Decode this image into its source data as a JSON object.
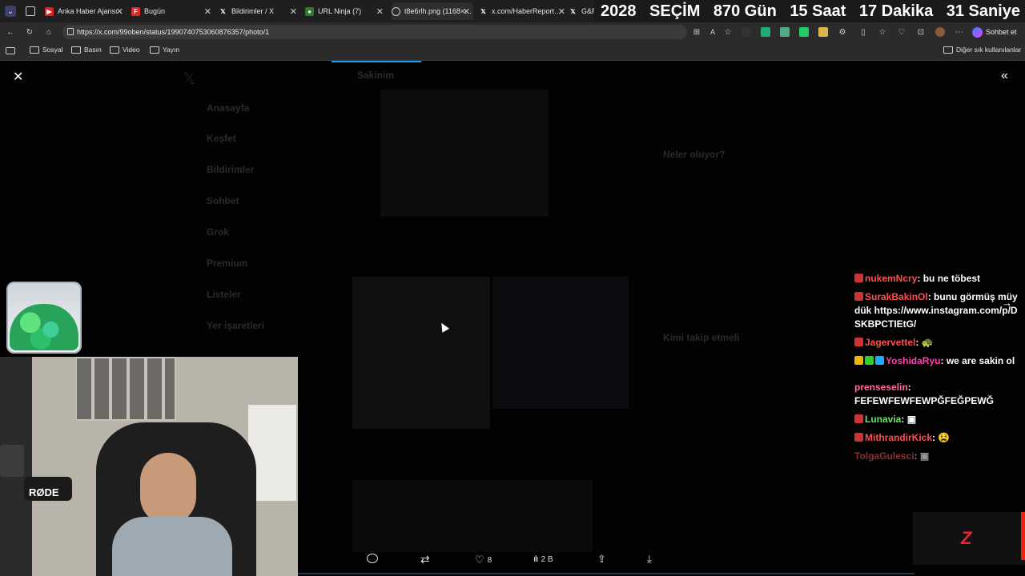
{
  "tabs": [
    {
      "label": "Anka Haber Ajansı",
      "icon": "youtube-icon",
      "color": "#e02020"
    },
    {
      "label": "Bugün",
      "icon": "flipboard-icon",
      "color": "#e12828"
    },
    {
      "label": "Bildirimler / X",
      "icon": "x-icon",
      "color": "#000000"
    },
    {
      "label": "URL Ninja (7)",
      "icon": "ninja-icon",
      "color": "#2d7a2d"
    },
    {
      "label": "t8e6rlh.png (1168×…",
      "icon": "globe-icon",
      "color": "#555555"
    },
    {
      "label": "x.com/HaberReport…",
      "icon": "x-icon",
      "color": "#000000"
    },
    {
      "label": "G&R",
      "icon": "x-icon",
      "color": "#000000"
    }
  ],
  "countdown": {
    "year": "2028",
    "title": "SEÇİM",
    "days": "870 Gün",
    "hours": "15 Saat",
    "minutes": "17 Dakika",
    "seconds": "31 Saniye"
  },
  "address": {
    "url": "https://x.com/99oben/status/1990740753060876357/photo/1",
    "chat_button": "Sohbet et"
  },
  "bookmarks": [
    "Sosyal",
    "Basın",
    "Video",
    "Yayın"
  ],
  "other_bookmarks": "Diğer sık kullanılanlar",
  "dim_page": {
    "nav": [
      "Anasayfa",
      "Keşfet",
      "Bildirimler",
      "Sohbet",
      "Grok",
      "Premium",
      "Listeler",
      "Yer işaretleri"
    ],
    "tab_title": "Sakinim",
    "trends_title": "Neler oluyor?",
    "follow_title": "Kimi takip etmeli"
  },
  "actions": {
    "likes": "8",
    "views": "2 B"
  },
  "chat": [
    {
      "user": "nukemNcry",
      "color": "#ff4d4d",
      "message": "bu ne töbest"
    },
    {
      "user": "SurakBakinOl",
      "color": "#ff4d4d",
      "message": "bunu görmüş müydük https://www.instagram.com/p/DSKBPCTIEtG/"
    },
    {
      "user": "Jagervettel",
      "color": "#ff4d4d",
      "message": "🐢"
    },
    {
      "user": "YoshidaRyu",
      "color": "#ff3fae",
      "message": "we are sakin ol"
    },
    {
      "user": "prensеselin",
      "color": "#ff6b9a",
      "message": "FEFEWFEWFEWPĞFEĞPEWĞ"
    },
    {
      "user": "Lunavia",
      "color": "#6ee06e",
      "message": "▣"
    },
    {
      "user": "MithrandirKick",
      "color": "#ff4d4d",
      "message": "😫"
    },
    {
      "user": "TolgaGulesci",
      "color": "#e05050",
      "message": "▣"
    }
  ],
  "cam": {
    "mic_label": "RØDE"
  }
}
